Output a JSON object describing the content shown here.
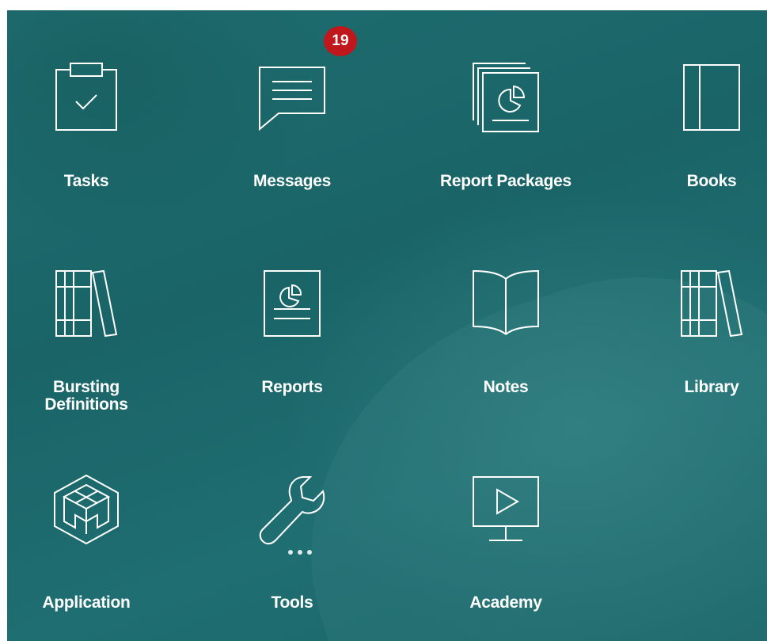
{
  "badges": {
    "messages_count": "19"
  },
  "tiles": [
    {
      "label": "Tasks",
      "icon": "clipboard-check-icon"
    },
    {
      "label": "Messages",
      "icon": "message-bubble-icon"
    },
    {
      "label": "Report Packages",
      "icon": "report-packages-icon"
    },
    {
      "label": "Books",
      "icon": "book-icon"
    },
    {
      "label": "Bursting Definitions",
      "icon": "binders-icon"
    },
    {
      "label": "Reports",
      "icon": "report-icon"
    },
    {
      "label": "Notes",
      "icon": "open-book-icon"
    },
    {
      "label": "Library",
      "icon": "library-icon"
    },
    {
      "label": "Application",
      "icon": "cube-icon"
    },
    {
      "label": "Tools",
      "icon": "wrench-icon"
    },
    {
      "label": "Academy",
      "icon": "video-monitor-icon"
    }
  ],
  "colors": {
    "background": "#1b6669",
    "badge": "#c0171c",
    "icon_stroke": "#ffffff"
  }
}
